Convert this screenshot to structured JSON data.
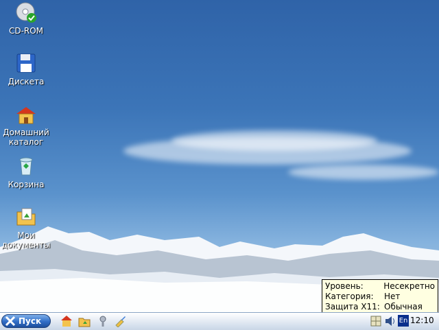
{
  "desktop": {
    "icons": [
      {
        "label": "CD-ROM",
        "icon": "cdrom-icon"
      },
      {
        "label": "Дискета",
        "icon": "floppy-icon"
      },
      {
        "label": "Домашний каталог",
        "icon": "home-folder-icon"
      },
      {
        "label": "Корзина",
        "icon": "trash-icon"
      },
      {
        "label": "Мои документы",
        "icon": "documents-folder-icon"
      }
    ]
  },
  "taskbar": {
    "start_label": "Пуск",
    "quick_launch": [
      "home-icon",
      "folder-icon",
      "tools-icon",
      "paint-icon"
    ],
    "tray": {
      "keyboard_layout": "En",
      "clock": "12:10"
    }
  },
  "tooltip": {
    "rows": [
      {
        "key": "Уровень:",
        "value": "Несекретно"
      },
      {
        "key": "Категория:",
        "value": "Нет"
      },
      {
        "key": "Защита X11:",
        "value": "Обычная"
      }
    ]
  }
}
